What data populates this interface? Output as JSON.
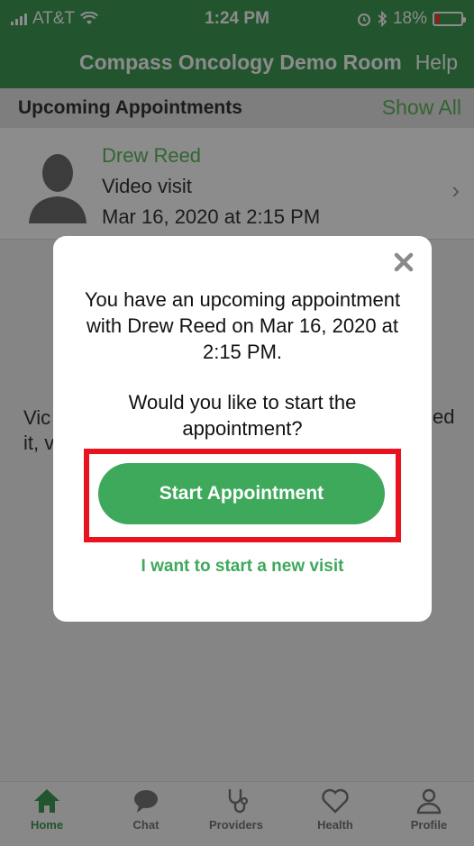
{
  "status_bar": {
    "carrier": "AT&T",
    "time": "1:24 PM",
    "battery": "18%",
    "battery_level": 0.18
  },
  "nav": {
    "title": "Compass Oncology Demo Room",
    "help_label": "Help"
  },
  "upcoming": {
    "header": "Upcoming Appointments",
    "show_all": "Show All",
    "appointment": {
      "provider": "Drew Reed",
      "type": "Video visit",
      "datetime": "Mar 16, 2020 at 2:15 PM"
    }
  },
  "background_text": {
    "left_line1": "Vic",
    "left_line2": "it, v",
    "right_fragment": "ed"
  },
  "modal": {
    "message": "You have an upcoming appointment with Drew Reed on Mar 16, 2020 at 2:15 PM.",
    "question": "Would you like to start the appointment?",
    "start_button": "Start Appointment",
    "new_visit_link": "I want to start a new visit"
  },
  "tabs": [
    {
      "label": "Home",
      "icon": "home-icon",
      "active": true
    },
    {
      "label": "Chat",
      "icon": "chat-icon",
      "active": false
    },
    {
      "label": "Providers",
      "icon": "stethoscope-icon",
      "active": false
    },
    {
      "label": "Health",
      "icon": "heart-icon",
      "active": false
    },
    {
      "label": "Profile",
      "icon": "person-icon",
      "active": false
    }
  ],
  "colors": {
    "brand_green": "#3f9a55",
    "button_green": "#3ea85b",
    "highlight_red": "#e8131f"
  }
}
